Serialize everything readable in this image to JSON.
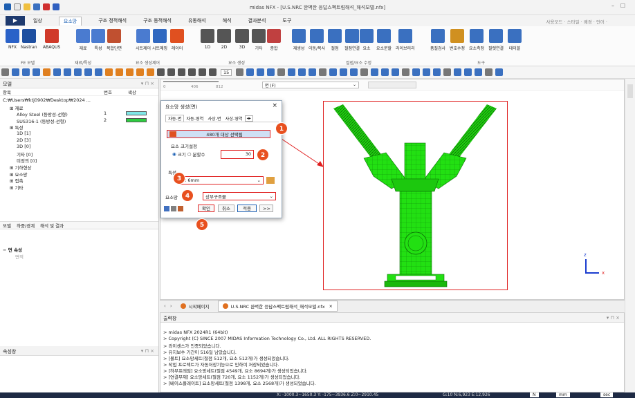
{
  "window": {
    "title": "midas NFX - [U.S.NRC 완벽한 응답스펙트럼해석_해석모델.nfx]",
    "right_menu": "사용모드 · 스타일 · 배경 · 언어 ·"
  },
  "menu": {
    "items": [
      "일상",
      "요소망",
      "구조 정적해석",
      "구조 동적해석",
      "유동해석",
      "해석",
      "결과분석",
      "도구"
    ]
  },
  "ribbon": {
    "buttons": [
      "NFX",
      "Nastran",
      "ABAQUS",
      "재료",
      "특성",
      "복합단면",
      "시트제어",
      "시트매핑",
      "레이어",
      "1D",
      "2D",
      "3D",
      "기타",
      "종합",
      "재생성",
      "이동/복사",
      "절점",
      "절점연결",
      "요소",
      "요소분할",
      "라이브러리",
      "품질검사",
      "번호수정",
      "요소측정",
      "필렛연결",
      "테이블"
    ],
    "groups": [
      "FE 모델",
      "재료/특성",
      "요소 생성제어",
      "요소 생성",
      "절점/요소 수정",
      "도구"
    ]
  },
  "toolbar": {
    "zoom": "15"
  },
  "leftpanel": {
    "title": "모델",
    "col_items": "항목",
    "col_num": "번호",
    "col_color": "색상",
    "tree": [
      {
        "t": "C:₩Users₩ktj0902₩Desktop₩2024 ...",
        "i": 0
      },
      {
        "t": "재료",
        "i": 1
      },
      {
        "t": "Alloy Steel (등방성-선형)",
        "n": "1",
        "i": 2,
        "c": "#7fe6e6"
      },
      {
        "t": "SUS316-1 (등방성-선형)",
        "n": "2",
        "i": 2,
        "c": "#2ecc40"
      },
      {
        "t": "특성",
        "i": 1
      },
      {
        "t": "1D [1]",
        "i": 2
      },
      {
        "t": "2D [3]",
        "i": 2
      },
      {
        "t": "3D [0]",
        "i": 2
      },
      {
        "t": "기타 [0]",
        "i": 2
      },
      {
        "t": "미정의 [0]",
        "i": 2
      },
      {
        "t": "기하형상",
        "i": 1
      },
      {
        "t": "요소망",
        "i": 1
      },
      {
        "t": "접촉",
        "i": 1
      },
      {
        "t": "기타",
        "i": 1
      }
    ],
    "tabs": [
      "모델",
      "하중/경계",
      "해석 및 결과"
    ],
    "prop_title": "속성창",
    "prop_item": "면 속성",
    "prop_sub": "면적"
  },
  "viewport": {
    "filter": "면 (F)",
    "ruler": [
      "0",
      "406",
      "812"
    ]
  },
  "dialog": {
    "title": "요소망 생성(면)",
    "tabs": [
      "자동-면",
      "자동-영역",
      "사상-면",
      "사상-영역"
    ],
    "select_text": "480개 대상 선택됨",
    "size_group": "요소 크기설정",
    "radio_size": "크기",
    "radio_div": "분할수",
    "size_value": "30",
    "prop_label": "특성",
    "prop_value": "1: 6mm",
    "mesh_label": "요소망",
    "mesh_value": "상부구조물",
    "btn_ok": "확인",
    "btn_cancel": "취소",
    "btn_apply": "적용",
    "btn_more": ">>"
  },
  "callouts": [
    "1",
    "2",
    "3",
    "4",
    "5"
  ],
  "tabs": [
    "시작페이지",
    "U.S.NRC 완벽한 응답스펙트럼해석_해석모델.nfx"
  ],
  "output": {
    "title": "출력창",
    "lines": [
      "> midas NFX 2024R1 (64bit)",
      "> Copyright (C) SINCE 2007 MIDAS Information Technology Co., Ltd. ALL RIGHTS RESERVED.",
      "> 라이센스가 인증되었습니다.",
      "> 유지보수 기간이 516일 남았습니다.",
      "> [볼트] 요소망세트(절점 512개, 요소 512개)가 생성되었습니다.",
      "> 작업 프로젝트가 자동저장기능으로 인하여 저장되었습니다.",
      "> [하부프레임] 요소망세트(절점 4549개, 요소 8694개)가 생성되었습니다.",
      "> [연결부재] 요소망세트(절점 720개, 요소 1152개)가 생성되었습니다.",
      "> [베이스플레이트] 요소망세트(절점 1398개, 요소 2568개)가 생성되었습니다."
    ]
  },
  "status": {
    "coords": "X: -1000.3~1650.3 Y: -175~3936.6 Z:0~2910.45",
    "count": "G:10 N:6,923 E:12,926",
    "unit_len": "N",
    "unit_mm": "mm",
    "unit_sec": "sec"
  },
  "axis": {
    "z": "z",
    "x": "x"
  },
  "colors": {
    "model": "#22dd10",
    "accent": "#e02020",
    "callout": "#e8501f"
  }
}
